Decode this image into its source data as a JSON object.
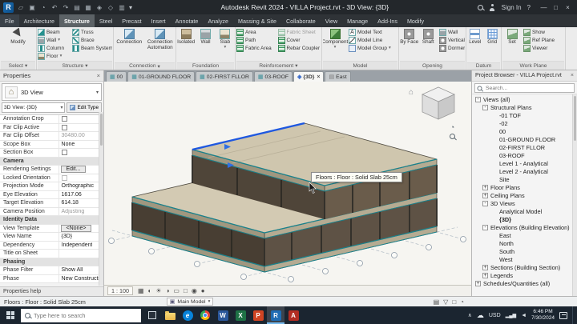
{
  "title_bar": {
    "app_title": "Autodesk Revit 2024 - VILLA Project.rvt - 3D View: {3D}",
    "sign_in": "Sign In",
    "qat_icons": [
      {
        "name": "open-icon",
        "glyph": "▱"
      },
      {
        "name": "save-icon",
        "glyph": "▣"
      },
      {
        "name": "sync-icon",
        "glyph": "◔"
      },
      {
        "name": "undo-icon",
        "glyph": "↶"
      },
      {
        "name": "redo-icon",
        "glyph": "↷"
      },
      {
        "name": "print-icon",
        "glyph": "▤"
      },
      {
        "name": "measure-icon",
        "glyph": "▦"
      },
      {
        "name": "tag-icon",
        "glyph": "◈"
      },
      {
        "name": "default-3d-view-icon",
        "glyph": "◇"
      },
      {
        "name": "section-icon",
        "glyph": "▥"
      }
    ]
  },
  "ribbon": {
    "tabs": [
      {
        "label": "File",
        "file": true
      },
      {
        "label": "Architecture"
      },
      {
        "label": "Structure",
        "active": true
      },
      {
        "label": "Steel"
      },
      {
        "label": "Precast"
      },
      {
        "label": "Insert"
      },
      {
        "label": "Annotate"
      },
      {
        "label": "Analyze"
      },
      {
        "label": "Massing & Site"
      },
      {
        "label": "Collaborate"
      },
      {
        "label": "View"
      },
      {
        "label": "Manage"
      },
      {
        "label": "Add-Ins"
      },
      {
        "label": "Modify"
      }
    ],
    "select": {
      "label": "Select",
      "modify": "Modify"
    },
    "structure": {
      "label": "Structure",
      "col1": [
        {
          "label": "Beam",
          "icon": "beam-icon"
        },
        {
          "label": "Wall",
          "icon": "wall-icon",
          "dd": "▾"
        },
        {
          "label": "Column",
          "icon": "column-icon"
        },
        {
          "label": "Floor",
          "icon": "floor-icon",
          "dd": "▾"
        }
      ],
      "col2": [
        {
          "label": "Truss",
          "icon": "truss-icon"
        },
        {
          "label": "Brace",
          "icon": "brace-icon"
        },
        {
          "label": "Beam System",
          "icon": "beam-system-icon"
        }
      ]
    },
    "connection": {
      "label": "Connection",
      "buttons": [
        {
          "label": "Connection",
          "icon": "connection-icon"
        },
        {
          "label": "Connection Automation",
          "icon": "connection-automation-icon"
        }
      ]
    },
    "foundation": {
      "label": "Foundation",
      "buttons": [
        {
          "label": "Isolated",
          "icon": "isolated-foundation-icon"
        },
        {
          "label": "Wall",
          "icon": "wall-foundation-icon"
        },
        {
          "label": "Slab",
          "icon": "slab-foundation-icon",
          "dd": "▾"
        }
      ]
    },
    "reinforcement": {
      "label": "Reinforcement",
      "col1": [
        {
          "label": "Area",
          "icon": "rebar-area-icon"
        },
        {
          "label": "Path",
          "icon": "rebar-path-icon"
        },
        {
          "label": "Fabric Area",
          "icon": "fabric-area-icon"
        }
      ],
      "col2": [
        {
          "label": "Fabric Sheet",
          "icon": "fabric-sheet-icon",
          "disabled": true
        },
        {
          "label": "Cover",
          "icon": "cover-icon"
        },
        {
          "label": "Rebar Coupler",
          "icon": "rebar-coupler-icon"
        }
      ]
    },
    "model": {
      "label": "Model",
      "buttons": [
        {
          "label": "Component",
          "icon": "component-icon",
          "dd": "▾"
        }
      ],
      "col": [
        {
          "label": "Model Text",
          "icon": "model-text-icon"
        },
        {
          "label": "Model Line",
          "icon": "model-line-icon"
        },
        {
          "label": "Model Group",
          "icon": "model-group-icon",
          "dd": "▾"
        }
      ]
    },
    "opening": {
      "label": "Opening",
      "buttons": [
        {
          "label": "By Face",
          "icon": "opening-by-face-icon"
        },
        {
          "label": "Shaft",
          "icon": "shaft-opening-icon"
        }
      ],
      "col": [
        {
          "label": "Wall",
          "icon": "wall-opening-icon"
        },
        {
          "label": "Vertical",
          "icon": "vertical-opening-icon"
        },
        {
          "label": "Dormer",
          "icon": "dormer-opening-icon"
        }
      ]
    },
    "datum": {
      "label": "Datum",
      "buttons": [
        {
          "label": "Level",
          "icon": "level-icon"
        },
        {
          "label": "Grid",
          "icon": "grid-icon"
        }
      ]
    },
    "workplane": {
      "label": "Work Plane",
      "buttons": [
        {
          "label": "Set",
          "icon": "set-workplane-icon"
        }
      ],
      "col": [
        {
          "label": "Show",
          "icon": "show-workplane-icon"
        },
        {
          "label": "Ref Plane",
          "icon": "ref-plane-icon"
        },
        {
          "label": "Viewer",
          "icon": "viewer-icon"
        }
      ]
    }
  },
  "view_tabs": [
    {
      "label": "00",
      "icon": "plan"
    },
    {
      "label": "01-GROUND FLOOR",
      "icon": "plan"
    },
    {
      "label": "02-FIRST FLLOR",
      "icon": "plan"
    },
    {
      "label": "03-ROOF",
      "icon": "plan"
    },
    {
      "label": "{3D}",
      "icon": "3d",
      "active": true,
      "closable": "×"
    },
    {
      "label": "East",
      "icon": "elev"
    }
  ],
  "properties": {
    "title": "Properties",
    "type_selector": "3D View",
    "instance_selector": "3D View: {3D}",
    "edit_type": "Edit Type",
    "rows": [
      {
        "label": "Annotation Crop",
        "kind": "check"
      },
      {
        "label": "Far Clip Active",
        "kind": "check"
      },
      {
        "label": "Far Clip Offset",
        "value": "30480.00",
        "disabled": true
      },
      {
        "label": "Scope Box",
        "value": "None"
      },
      {
        "label": "Section Box",
        "kind": "check"
      },
      {
        "label": "Camera",
        "kind": "header"
      },
      {
        "label": "Rendering Settings",
        "value": "Edit...",
        "kind": "button"
      },
      {
        "label": "Locked Orientation",
        "kind": "check",
        "disabled": true
      },
      {
        "label": "Projection Mode",
        "value": "Orthographic"
      },
      {
        "label": "Eye Elevation",
        "value": "1617.06"
      },
      {
        "label": "Target Elevation",
        "value": "614.18"
      },
      {
        "label": "Camera Position",
        "value": "Adjusting",
        "disabled": true
      },
      {
        "label": "Identity Data",
        "kind": "header"
      },
      {
        "label": "View Template",
        "value": "<None>",
        "kind": "button"
      },
      {
        "label": "View Name",
        "value": "{3D}"
      },
      {
        "label": "Dependency",
        "value": "Independent"
      },
      {
        "label": "Title on Sheet",
        "value": ""
      },
      {
        "label": "Phasing",
        "kind": "header"
      },
      {
        "label": "Phase Filter",
        "value": "Show All"
      },
      {
        "label": "Phase",
        "value": "New Construction"
      }
    ],
    "help": "Properties help"
  },
  "viewport": {
    "tooltip": "Floors : Floor : Solid Slab 25cm"
  },
  "view_control": {
    "scale": "1 : 100",
    "icons": [
      {
        "name": "detail-level-icon",
        "glyph": "▦"
      },
      {
        "name": "visual-style-icon",
        "glyph": "◐"
      },
      {
        "name": "sun-path-icon",
        "glyph": "☀"
      },
      {
        "name": "shadows-icon",
        "glyph": "◑"
      },
      {
        "name": "crop-view-icon",
        "glyph": "▭"
      },
      {
        "name": "show-crop-icon",
        "glyph": "□"
      },
      {
        "name": "temporary-hide-isolate-icon",
        "glyph": "◉"
      },
      {
        "name": "reveal-hidden-icon",
        "glyph": "●"
      }
    ]
  },
  "browser": {
    "title": "Project Browser - VILLA Project.rvt",
    "search_placeholder": "Search...",
    "tree": [
      {
        "level": 0,
        "exp": "-",
        "label": "Views (all)"
      },
      {
        "level": 1,
        "exp": "-",
        "label": "Structural Plans"
      },
      {
        "level": 2,
        "exp": "",
        "label": "-01 TOF"
      },
      {
        "level": 2,
        "exp": "",
        "label": "-02"
      },
      {
        "level": 2,
        "exp": "",
        "label": "00"
      },
      {
        "level": 2,
        "exp": "",
        "label": "01-GROUND FLOOR"
      },
      {
        "level": 2,
        "exp": "",
        "label": "02-FIRST FLLOR"
      },
      {
        "level": 2,
        "exp": "",
        "label": "03-ROOF"
      },
      {
        "level": 2,
        "exp": "",
        "label": "Level 1 - Analytical"
      },
      {
        "level": 2,
        "exp": "",
        "label": "Level 2 - Analytical"
      },
      {
        "level": 2,
        "exp": "",
        "label": "Site"
      },
      {
        "level": 1,
        "exp": "+",
        "label": "Floor Plans"
      },
      {
        "level": 1,
        "exp": "+",
        "label": "Ceiling Plans"
      },
      {
        "level": 1,
        "exp": "-",
        "label": "3D Views"
      },
      {
        "level": 2,
        "exp": "",
        "label": "Analytical Model"
      },
      {
        "level": 2,
        "exp": "",
        "label": "{3D}",
        "bold": true
      },
      {
        "level": 1,
        "exp": "-",
        "label": "Elevations (Building Elevation)"
      },
      {
        "level": 2,
        "exp": "",
        "label": "East"
      },
      {
        "level": 2,
        "exp": "",
        "label": "North"
      },
      {
        "level": 2,
        "exp": "",
        "label": "South"
      },
      {
        "level": 2,
        "exp": "",
        "label": "West"
      },
      {
        "level": 1,
        "exp": "+",
        "label": "Sections (Building Section)"
      },
      {
        "level": 1,
        "exp": "+",
        "label": "Legends"
      },
      {
        "level": 0,
        "exp": "+",
        "label": "Schedules/Quantities (all)"
      }
    ]
  },
  "statusbar": {
    "selection": "Floors : Floor : Solid Slab 25cm",
    "design_option": "Main Model",
    "icons": [
      {
        "name": "worksets-icon",
        "glyph": "▤"
      },
      {
        "name": "filter-icon",
        "glyph": "▽"
      },
      {
        "name": "select-toggle-icon",
        "glyph": "□"
      },
      {
        "name": "background-process-icon",
        "glyph": "◔"
      }
    ]
  },
  "taskbar": {
    "search_placeholder": "Type here to search",
    "icons": [
      {
        "name": "task-view-icon",
        "kind": "taskview"
      },
      {
        "name": "file-explorer-icon",
        "kind": "folder"
      },
      {
        "name": "edge-icon",
        "kind": "edge",
        "glyph": "e"
      },
      {
        "name": "chrome-icon",
        "kind": "chrome"
      },
      {
        "name": "word-icon",
        "kind": "word",
        "glyph": "W"
      },
      {
        "name": "excel-icon",
        "kind": "excel",
        "glyph": "X"
      },
      {
        "name": "powerpoint-icon",
        "kind": "ppt",
        "glyph": "P"
      },
      {
        "name": "revit-taskbar-icon",
        "kind": "revit",
        "glyph": "R",
        "active": true
      },
      {
        "name": "autocad-icon",
        "kind": "acad",
        "glyph": "A"
      }
    ],
    "tray_text": "USD",
    "clock": {
      "time": "6:46 PM",
      "date": "7/30/2024"
    }
  }
}
